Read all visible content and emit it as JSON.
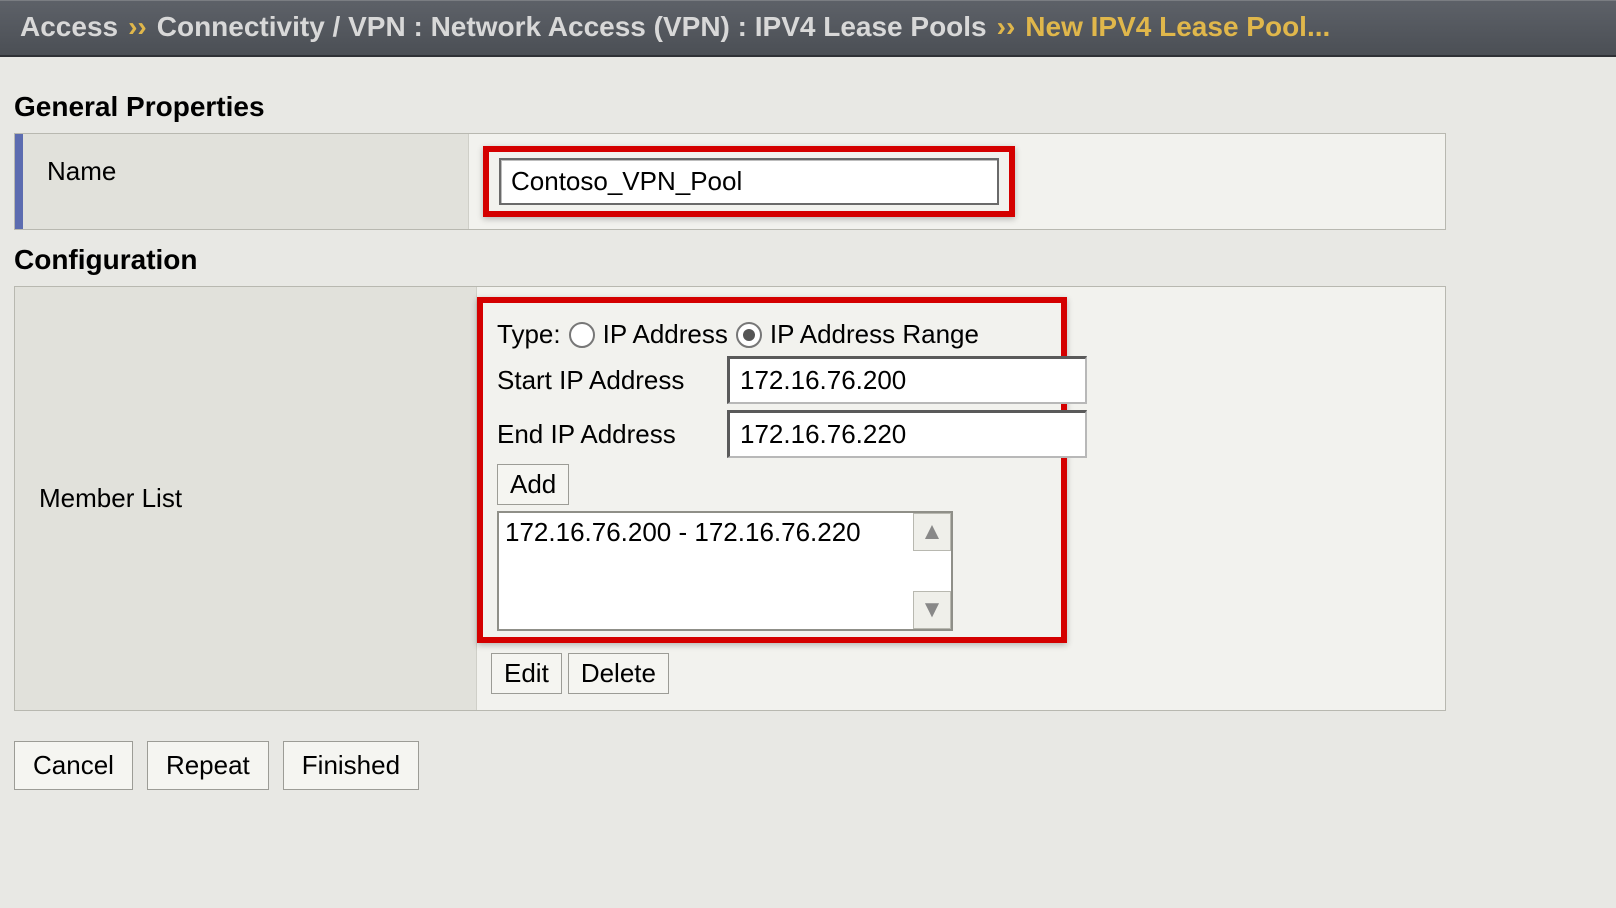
{
  "breadcrumb": {
    "seg1": "Access",
    "sep": "››",
    "seg2": "Connectivity / VPN : Network Access (VPN) : IPV4 Lease Pools",
    "current": "New IPV4 Lease Pool..."
  },
  "sections": {
    "general_heading": "General Properties",
    "config_heading": "Configuration"
  },
  "general": {
    "name_label": "Name",
    "name_value": "Contoso_VPN_Pool"
  },
  "config": {
    "member_list_label": "Member List",
    "type_label": "Type:",
    "type_option_ip": "IP Address",
    "type_option_range": "IP Address Range",
    "type_selected": "range",
    "start_ip_label": "Start IP Address",
    "start_ip_value": "172.16.76.200",
    "end_ip_label": "End IP Address",
    "end_ip_value": "172.16.76.220",
    "add_label": "Add",
    "member_items": [
      "172.16.76.200 - 172.16.76.220"
    ],
    "edit_label": "Edit",
    "delete_label": "Delete"
  },
  "buttons": {
    "cancel": "Cancel",
    "repeat": "Repeat",
    "finished": "Finished"
  }
}
